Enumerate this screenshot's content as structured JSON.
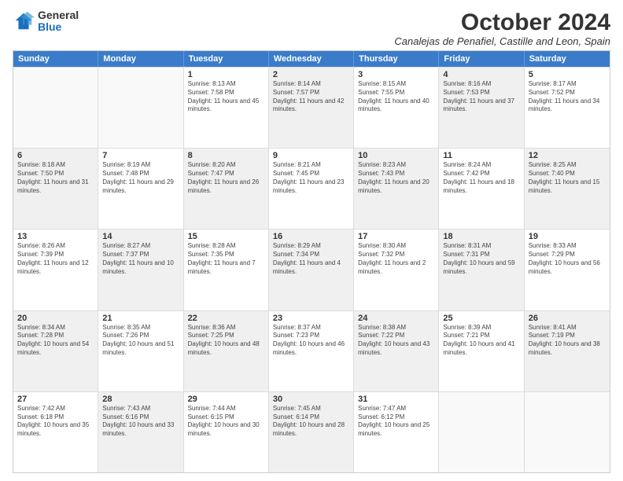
{
  "logo": {
    "general": "General",
    "blue": "Blue"
  },
  "title": "October 2024",
  "subtitle": "Canalejas de Penafiel, Castille and Leon, Spain",
  "headers": [
    "Sunday",
    "Monday",
    "Tuesday",
    "Wednesday",
    "Thursday",
    "Friday",
    "Saturday"
  ],
  "weeks": [
    [
      {
        "day": "",
        "sunrise": "",
        "sunset": "",
        "daylight": "",
        "shaded": false,
        "empty": true
      },
      {
        "day": "",
        "sunrise": "",
        "sunset": "",
        "daylight": "",
        "shaded": false,
        "empty": true
      },
      {
        "day": "1",
        "sunrise": "Sunrise: 8:13 AM",
        "sunset": "Sunset: 7:58 PM",
        "daylight": "Daylight: 11 hours and 45 minutes.",
        "shaded": false,
        "empty": false
      },
      {
        "day": "2",
        "sunrise": "Sunrise: 8:14 AM",
        "sunset": "Sunset: 7:57 PM",
        "daylight": "Daylight: 11 hours and 42 minutes.",
        "shaded": true,
        "empty": false
      },
      {
        "day": "3",
        "sunrise": "Sunrise: 8:15 AM",
        "sunset": "Sunset: 7:55 PM",
        "daylight": "Daylight: 11 hours and 40 minutes.",
        "shaded": false,
        "empty": false
      },
      {
        "day": "4",
        "sunrise": "Sunrise: 8:16 AM",
        "sunset": "Sunset: 7:53 PM",
        "daylight": "Daylight: 11 hours and 37 minutes.",
        "shaded": true,
        "empty": false
      },
      {
        "day": "5",
        "sunrise": "Sunrise: 8:17 AM",
        "sunset": "Sunset: 7:52 PM",
        "daylight": "Daylight: 11 hours and 34 minutes.",
        "shaded": false,
        "empty": false
      }
    ],
    [
      {
        "day": "6",
        "sunrise": "Sunrise: 8:18 AM",
        "sunset": "Sunset: 7:50 PM",
        "daylight": "Daylight: 11 hours and 31 minutes.",
        "shaded": true,
        "empty": false
      },
      {
        "day": "7",
        "sunrise": "Sunrise: 8:19 AM",
        "sunset": "Sunset: 7:48 PM",
        "daylight": "Daylight: 11 hours and 29 minutes.",
        "shaded": false,
        "empty": false
      },
      {
        "day": "8",
        "sunrise": "Sunrise: 8:20 AM",
        "sunset": "Sunset: 7:47 PM",
        "daylight": "Daylight: 11 hours and 26 minutes.",
        "shaded": true,
        "empty": false
      },
      {
        "day": "9",
        "sunrise": "Sunrise: 8:21 AM",
        "sunset": "Sunset: 7:45 PM",
        "daylight": "Daylight: 11 hours and 23 minutes.",
        "shaded": false,
        "empty": false
      },
      {
        "day": "10",
        "sunrise": "Sunrise: 8:23 AM",
        "sunset": "Sunset: 7:43 PM",
        "daylight": "Daylight: 11 hours and 20 minutes.",
        "shaded": true,
        "empty": false
      },
      {
        "day": "11",
        "sunrise": "Sunrise: 8:24 AM",
        "sunset": "Sunset: 7:42 PM",
        "daylight": "Daylight: 11 hours and 18 minutes.",
        "shaded": false,
        "empty": false
      },
      {
        "day": "12",
        "sunrise": "Sunrise: 8:25 AM",
        "sunset": "Sunset: 7:40 PM",
        "daylight": "Daylight: 11 hours and 15 minutes.",
        "shaded": true,
        "empty": false
      }
    ],
    [
      {
        "day": "13",
        "sunrise": "Sunrise: 8:26 AM",
        "sunset": "Sunset: 7:39 PM",
        "daylight": "Daylight: 11 hours and 12 minutes.",
        "shaded": false,
        "empty": false
      },
      {
        "day": "14",
        "sunrise": "Sunrise: 8:27 AM",
        "sunset": "Sunset: 7:37 PM",
        "daylight": "Daylight: 11 hours and 10 minutes.",
        "shaded": true,
        "empty": false
      },
      {
        "day": "15",
        "sunrise": "Sunrise: 8:28 AM",
        "sunset": "Sunset: 7:35 PM",
        "daylight": "Daylight: 11 hours and 7 minutes.",
        "shaded": false,
        "empty": false
      },
      {
        "day": "16",
        "sunrise": "Sunrise: 8:29 AM",
        "sunset": "Sunset: 7:34 PM",
        "daylight": "Daylight: 11 hours and 4 minutes.",
        "shaded": true,
        "empty": false
      },
      {
        "day": "17",
        "sunrise": "Sunrise: 8:30 AM",
        "sunset": "Sunset: 7:32 PM",
        "daylight": "Daylight: 11 hours and 2 minutes.",
        "shaded": false,
        "empty": false
      },
      {
        "day": "18",
        "sunrise": "Sunrise: 8:31 AM",
        "sunset": "Sunset: 7:31 PM",
        "daylight": "Daylight: 10 hours and 59 minutes.",
        "shaded": true,
        "empty": false
      },
      {
        "day": "19",
        "sunrise": "Sunrise: 8:33 AM",
        "sunset": "Sunset: 7:29 PM",
        "daylight": "Daylight: 10 hours and 56 minutes.",
        "shaded": false,
        "empty": false
      }
    ],
    [
      {
        "day": "20",
        "sunrise": "Sunrise: 8:34 AM",
        "sunset": "Sunset: 7:28 PM",
        "daylight": "Daylight: 10 hours and 54 minutes.",
        "shaded": true,
        "empty": false
      },
      {
        "day": "21",
        "sunrise": "Sunrise: 8:35 AM",
        "sunset": "Sunset: 7:26 PM",
        "daylight": "Daylight: 10 hours and 51 minutes.",
        "shaded": false,
        "empty": false
      },
      {
        "day": "22",
        "sunrise": "Sunrise: 8:36 AM",
        "sunset": "Sunset: 7:25 PM",
        "daylight": "Daylight: 10 hours and 48 minutes.",
        "shaded": true,
        "empty": false
      },
      {
        "day": "23",
        "sunrise": "Sunrise: 8:37 AM",
        "sunset": "Sunset: 7:23 PM",
        "daylight": "Daylight: 10 hours and 46 minutes.",
        "shaded": false,
        "empty": false
      },
      {
        "day": "24",
        "sunrise": "Sunrise: 8:38 AM",
        "sunset": "Sunset: 7:22 PM",
        "daylight": "Daylight: 10 hours and 43 minutes.",
        "shaded": true,
        "empty": false
      },
      {
        "day": "25",
        "sunrise": "Sunrise: 8:39 AM",
        "sunset": "Sunset: 7:21 PM",
        "daylight": "Daylight: 10 hours and 41 minutes.",
        "shaded": false,
        "empty": false
      },
      {
        "day": "26",
        "sunrise": "Sunrise: 8:41 AM",
        "sunset": "Sunset: 7:19 PM",
        "daylight": "Daylight: 10 hours and 38 minutes.",
        "shaded": true,
        "empty": false
      }
    ],
    [
      {
        "day": "27",
        "sunrise": "Sunrise: 7:42 AM",
        "sunset": "Sunset: 6:18 PM",
        "daylight": "Daylight: 10 hours and 35 minutes.",
        "shaded": false,
        "empty": false
      },
      {
        "day": "28",
        "sunrise": "Sunrise: 7:43 AM",
        "sunset": "Sunset: 6:16 PM",
        "daylight": "Daylight: 10 hours and 33 minutes.",
        "shaded": true,
        "empty": false
      },
      {
        "day": "29",
        "sunrise": "Sunrise: 7:44 AM",
        "sunset": "Sunset: 6:15 PM",
        "daylight": "Daylight: 10 hours and 30 minutes.",
        "shaded": false,
        "empty": false
      },
      {
        "day": "30",
        "sunrise": "Sunrise: 7:45 AM",
        "sunset": "Sunset: 6:14 PM",
        "daylight": "Daylight: 10 hours and 28 minutes.",
        "shaded": true,
        "empty": false
      },
      {
        "day": "31",
        "sunrise": "Sunrise: 7:47 AM",
        "sunset": "Sunset: 6:12 PM",
        "daylight": "Daylight: 10 hours and 25 minutes.",
        "shaded": false,
        "empty": false
      },
      {
        "day": "",
        "sunrise": "",
        "sunset": "",
        "daylight": "",
        "shaded": true,
        "empty": true
      },
      {
        "day": "",
        "sunrise": "",
        "sunset": "",
        "daylight": "",
        "shaded": false,
        "empty": true
      }
    ]
  ]
}
